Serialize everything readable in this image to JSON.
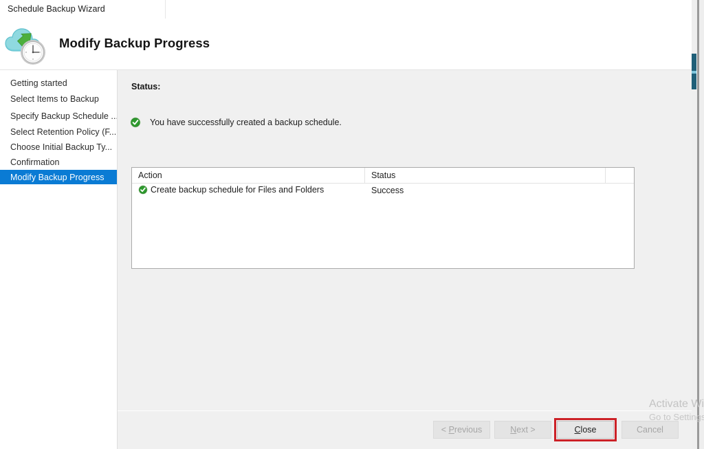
{
  "window": {
    "title": "Schedule Backup Wizard"
  },
  "header": {
    "title": "Modify Backup Progress",
    "logo_icon": "cloud-backup-clock-icon"
  },
  "sidebar": {
    "items": [
      {
        "label": "Getting started",
        "selected": false
      },
      {
        "label": "Select Items to Backup",
        "selected": false
      },
      {
        "label": "Specify Backup Schedule ...",
        "selected": false
      },
      {
        "label": "Select Retention Policy (F...",
        "selected": false
      },
      {
        "label": "Choose Initial Backup Ty...",
        "selected": false
      },
      {
        "label": "Confirmation",
        "selected": false
      },
      {
        "label": "Modify Backup Progress",
        "selected": true
      }
    ],
    "selected_color": "#0a7bd4"
  },
  "content": {
    "status_label": "Status:",
    "success_icon": "green-check-circle-icon",
    "success_message": "You have successfully created a backup schedule.",
    "table": {
      "columns": [
        "Action",
        "Status"
      ],
      "rows": [
        {
          "icon": "green-check-circle-icon",
          "action": "Create backup schedule for Files and Folders",
          "status": "Success"
        }
      ]
    }
  },
  "footer": {
    "buttons": [
      {
        "name": "previous",
        "label_prefix": "< ",
        "accel": "P",
        "label_suffix": "revious",
        "disabled": true,
        "highlighted": false
      },
      {
        "name": "next",
        "label_prefix": "",
        "accel": "N",
        "label_suffix": "ext >",
        "disabled": true,
        "highlighted": false
      },
      {
        "name": "close",
        "label_prefix": "",
        "accel": "C",
        "label_suffix": "lose",
        "disabled": false,
        "highlighted": true
      },
      {
        "name": "cancel",
        "label_prefix": "",
        "accel": "",
        "label_suffix": "Cancel",
        "disabled": true,
        "highlighted": false
      }
    ],
    "highlight_color": "#cc2127"
  },
  "watermark": {
    "title": "Activate Windows",
    "subtitle": "Go to Settings to activate Windows."
  }
}
